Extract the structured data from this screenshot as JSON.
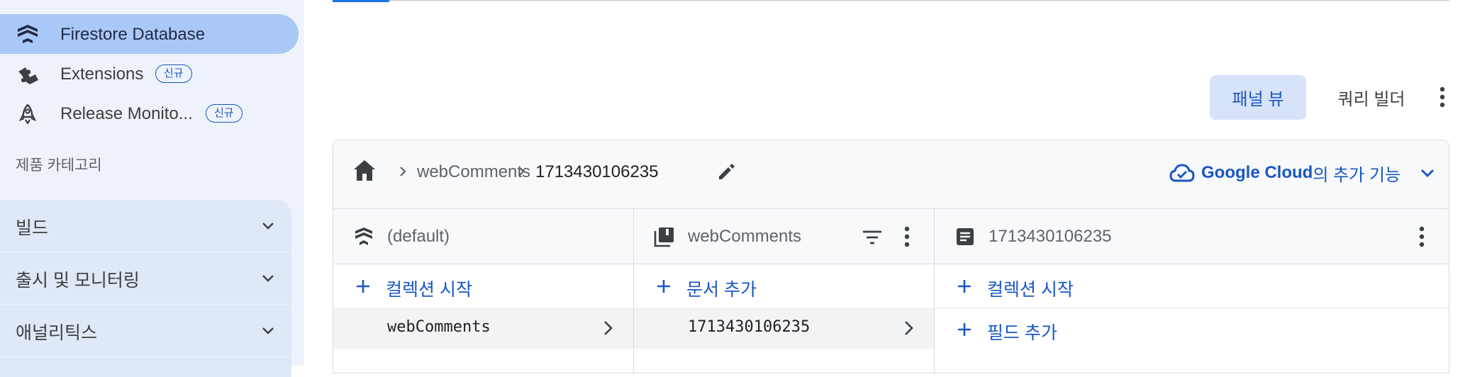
{
  "sidebar": {
    "items": [
      {
        "label": "Firestore Database",
        "icon": "firestore-icon",
        "active": true
      },
      {
        "label": "Extensions",
        "icon": "extensions-icon",
        "badge": "신규"
      },
      {
        "label": "Release Monito...",
        "icon": "rocket-icon",
        "badge": "신규"
      }
    ],
    "category_title": "제품 카테고리",
    "groups": [
      {
        "label": "빌드"
      },
      {
        "label": "출시 및 모니터링"
      },
      {
        "label": "애널리틱스"
      }
    ]
  },
  "toolbar": {
    "panel_view_label": "패널 뷰",
    "query_builder_label": "쿼리 빌더"
  },
  "breadcrumb": {
    "collection": "webComments",
    "document": "1713430106235"
  },
  "google_cloud": {
    "brand": "Google Cloud",
    "suffix": "의 추가 기능"
  },
  "columns": {
    "root": {
      "title": "(default)",
      "action": "컬렉션 시작",
      "rows": [
        "webComments"
      ]
    },
    "collection": {
      "title": "webComments",
      "action": "문서 추가",
      "rows": [
        "1713430106235"
      ]
    },
    "document": {
      "title": "1713430106235",
      "action": "컬렉션 시작",
      "action2": "필드 추가"
    }
  },
  "colors": {
    "accent": "#1a56c4",
    "active_nav": "#aac8f7",
    "sidebar_bg": "#eef3fb"
  }
}
